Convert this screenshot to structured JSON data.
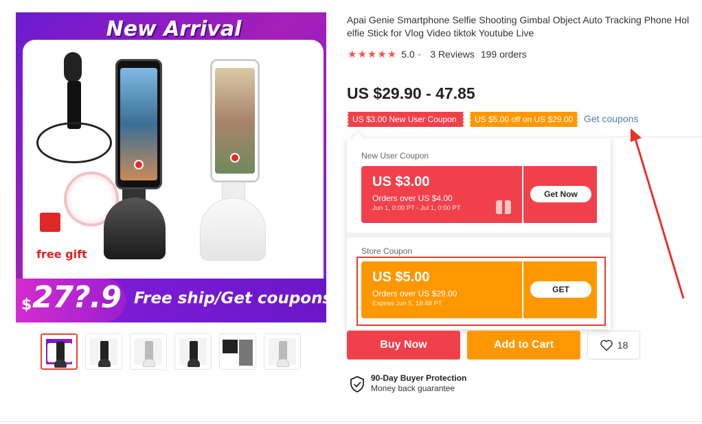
{
  "product_image": {
    "banner_top": "New Arrival",
    "free_gift": "free gift",
    "price_symbol": "$",
    "price_big": "27?.9",
    "ship_text": "Free ship/Get coupons"
  },
  "thumbnails": [
    {
      "name": "thumb-1",
      "active": true
    },
    {
      "name": "thumb-2",
      "active": false
    },
    {
      "name": "thumb-3",
      "active": false
    },
    {
      "name": "thumb-4",
      "active": false
    },
    {
      "name": "thumb-5",
      "active": false
    },
    {
      "name": "thumb-6",
      "active": false
    }
  ],
  "product": {
    "title_line1": "Apai Genie Smartphone Selfie Shooting Gimbal Object Auto Tracking Phone Hol",
    "title_line2": "elfie Stick for Vlog Video tiktok Youtube Live",
    "stars": "★★★★★",
    "rating": "5.0",
    "reviews": "3 Reviews",
    "orders": "199 orders",
    "price": "US $29.90 - 47.85"
  },
  "coupon_tags": {
    "new_user": "US $3.00 New User Coupon",
    "store": "US $5.00 off on US $29.00",
    "get_coupons": "Get coupons"
  },
  "popup": {
    "section1_label": "New User Coupon",
    "section2_label": "Store Coupon",
    "coupons": [
      {
        "amount": "US $3.00",
        "condition": "Orders over US $4.00",
        "dates": "Jun 1, 0:00 PT - Jul 1, 0:00 PT",
        "button": "Get Now"
      },
      {
        "amount": "US $5.00",
        "condition": "Orders over US $29.00",
        "dates": "Expires Jun 5, 19:48 PT",
        "button": "GET"
      }
    ]
  },
  "actions": {
    "buy_now": "Buy Now",
    "add_to_cart": "Add to Cart",
    "wishlist_count": "18"
  },
  "protection": {
    "title": "90-Day Buyer Protection",
    "subtitle": "Money back guarantee"
  },
  "colors": {
    "accent_red": "#f2404b",
    "accent_orange": "#ff9800",
    "link_blue": "#4a7fb5",
    "banner_purple": "#7b1bd6"
  }
}
